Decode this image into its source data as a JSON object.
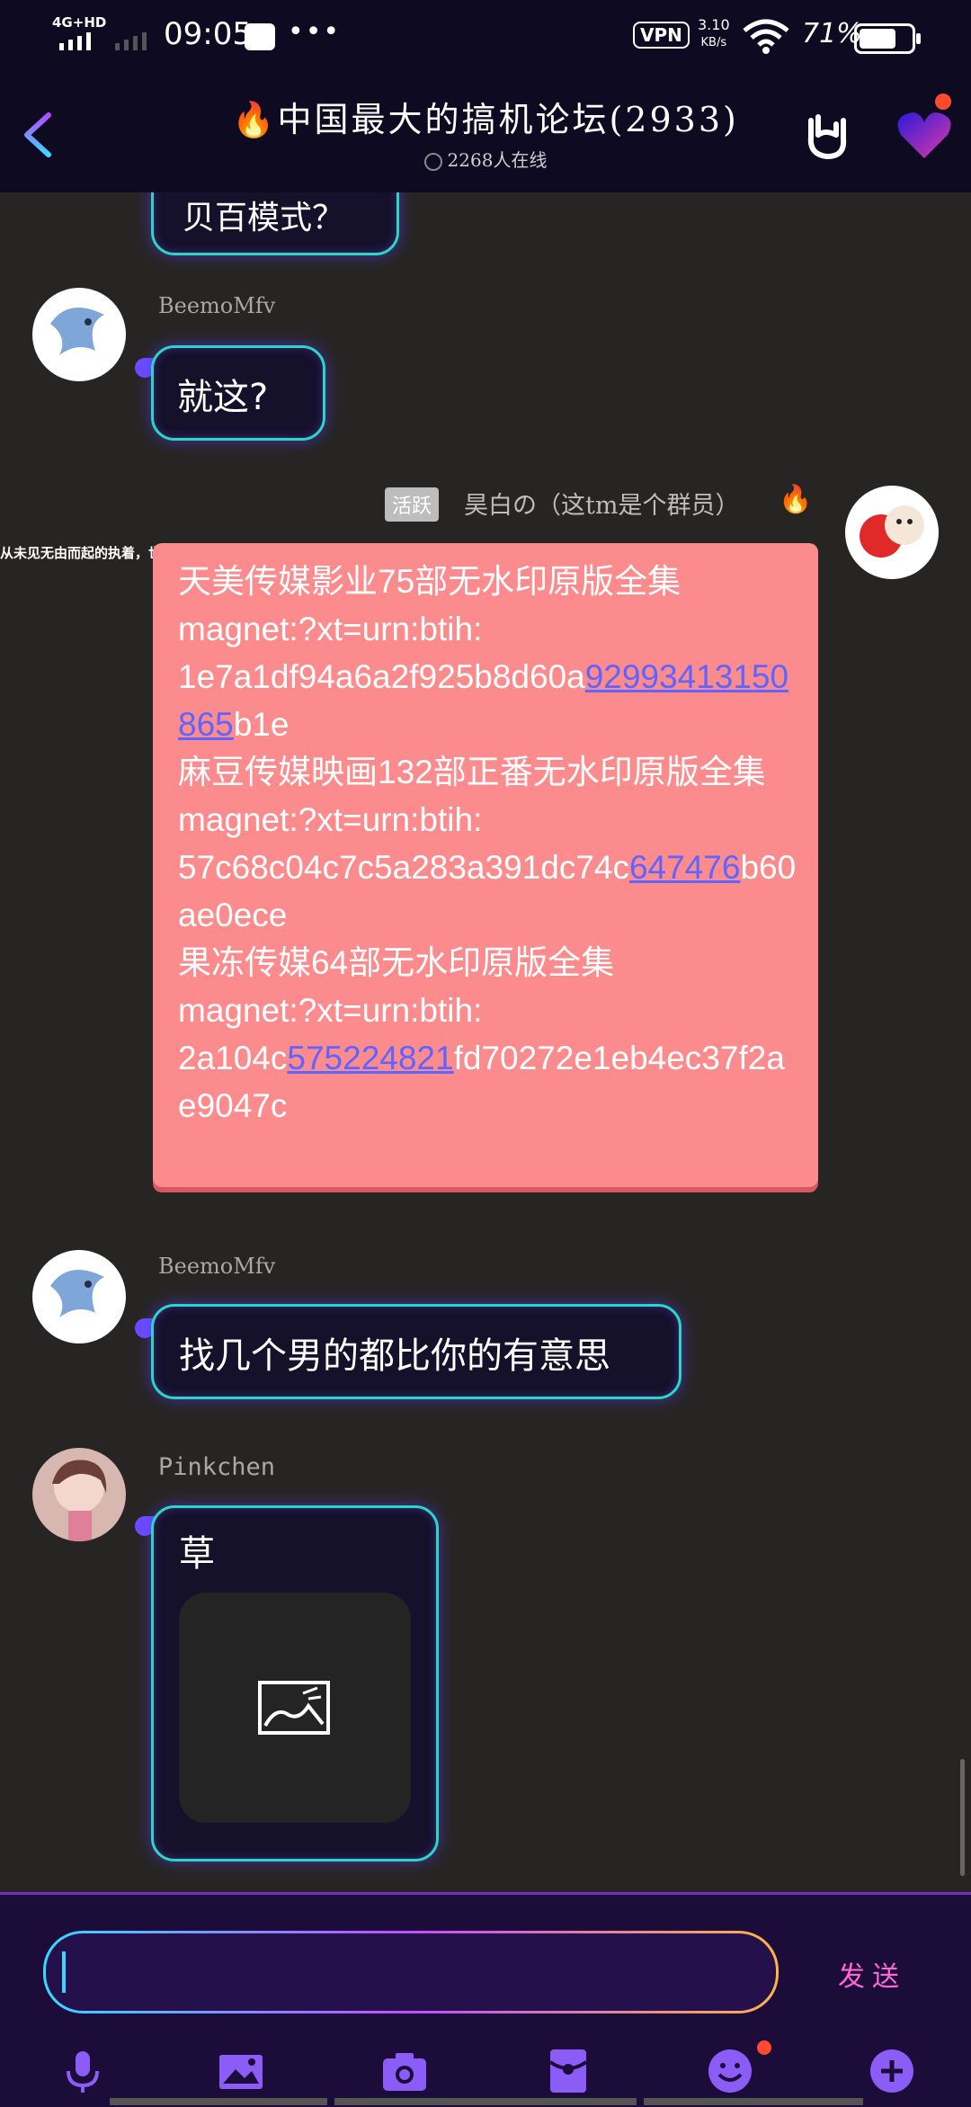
{
  "status_bar": {
    "network": "4G+HD",
    "time": "09:05",
    "more": "•••",
    "vpn": "VPN",
    "speed_value": "3.10",
    "speed_unit": "KB/s",
    "battery": "71%"
  },
  "header": {
    "title": "🔥中国最大的搞机论坛(2933)",
    "subtitle": "2268人在线"
  },
  "messages": [
    {
      "partial_text": "贝百模式？"
    },
    {
      "sender": "BeemoMfv",
      "text": "就这?"
    },
    {
      "badge": "活跃",
      "sender": "昊白の（这tm是个群员）",
      "signature": "从未见无由而起的执着，世上本没有无因而来的孤屁",
      "lines": [
        "天美传媒影业75部无水印原版全集",
        "magnet:?xt=urn:btih:",
        "1e7a1df94a6a2f925b8d60a",
        "92993413150865",
        "b1e",
        "麻豆传媒映画132部正番无水印原版全集",
        "magnet:?xt=urn:btih:",
        "57c68c04c7c5a283a391dc74c",
        "647476",
        "b60ae0ece",
        "果冻传媒64部无水印原版全集",
        "magnet:?xt=urn:btih:",
        "2a104c",
        "575224821",
        "fd70272e1eb4ec37f2ae9047c"
      ]
    },
    {
      "sender": "BeemoMfv",
      "text": "找几个男的都比你的有意思"
    },
    {
      "sender": "Pinkchen",
      "text": "草"
    }
  ],
  "input": {
    "send_label": "发送"
  },
  "colors": {
    "accent": "#2ad7c5",
    "bubble_bg": "#15112b",
    "pink_box": "#fb8b8c",
    "link": "#5f63ff",
    "send": "#ff66d6",
    "header_bg": "#0d0a22",
    "chat_bg": "#272524"
  }
}
